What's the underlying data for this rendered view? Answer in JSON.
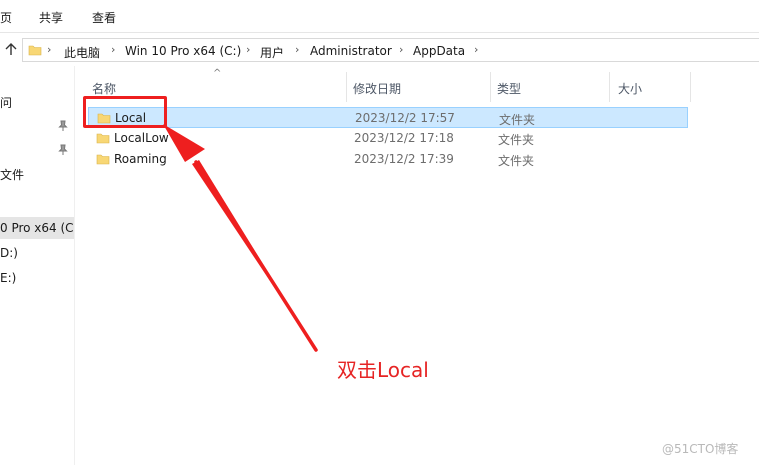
{
  "ribbon": {
    "tabs": [
      "页",
      "共享",
      "查看"
    ]
  },
  "address": {
    "crumbs": [
      "此电脑",
      "Win 10 Pro x64 (C:)",
      "用户",
      "Administrator",
      "AppData"
    ]
  },
  "nav": {
    "items": [
      "问",
      "文件",
      "0 Pro x64 (C",
      "D:)",
      "E:)"
    ]
  },
  "columns": {
    "name": "名称",
    "date": "修改日期",
    "type": "类型",
    "size": "大小"
  },
  "files": [
    {
      "name": "Local",
      "date": "2023/12/2 17:57",
      "type": "文件夹",
      "selected": true
    },
    {
      "name": "LocalLow",
      "date": "2023/12/2 17:18",
      "type": "文件夹",
      "selected": false
    },
    {
      "name": "Roaming",
      "date": "2023/12/2 17:39",
      "type": "文件夹",
      "selected": false
    }
  ],
  "annotation": {
    "text": "双击Local"
  },
  "watermark": {
    "text": "@51CTO博客"
  },
  "colors": {
    "accent_red": "#ee1f1f",
    "selection": "#cce8ff",
    "folder": "#f8d775"
  }
}
